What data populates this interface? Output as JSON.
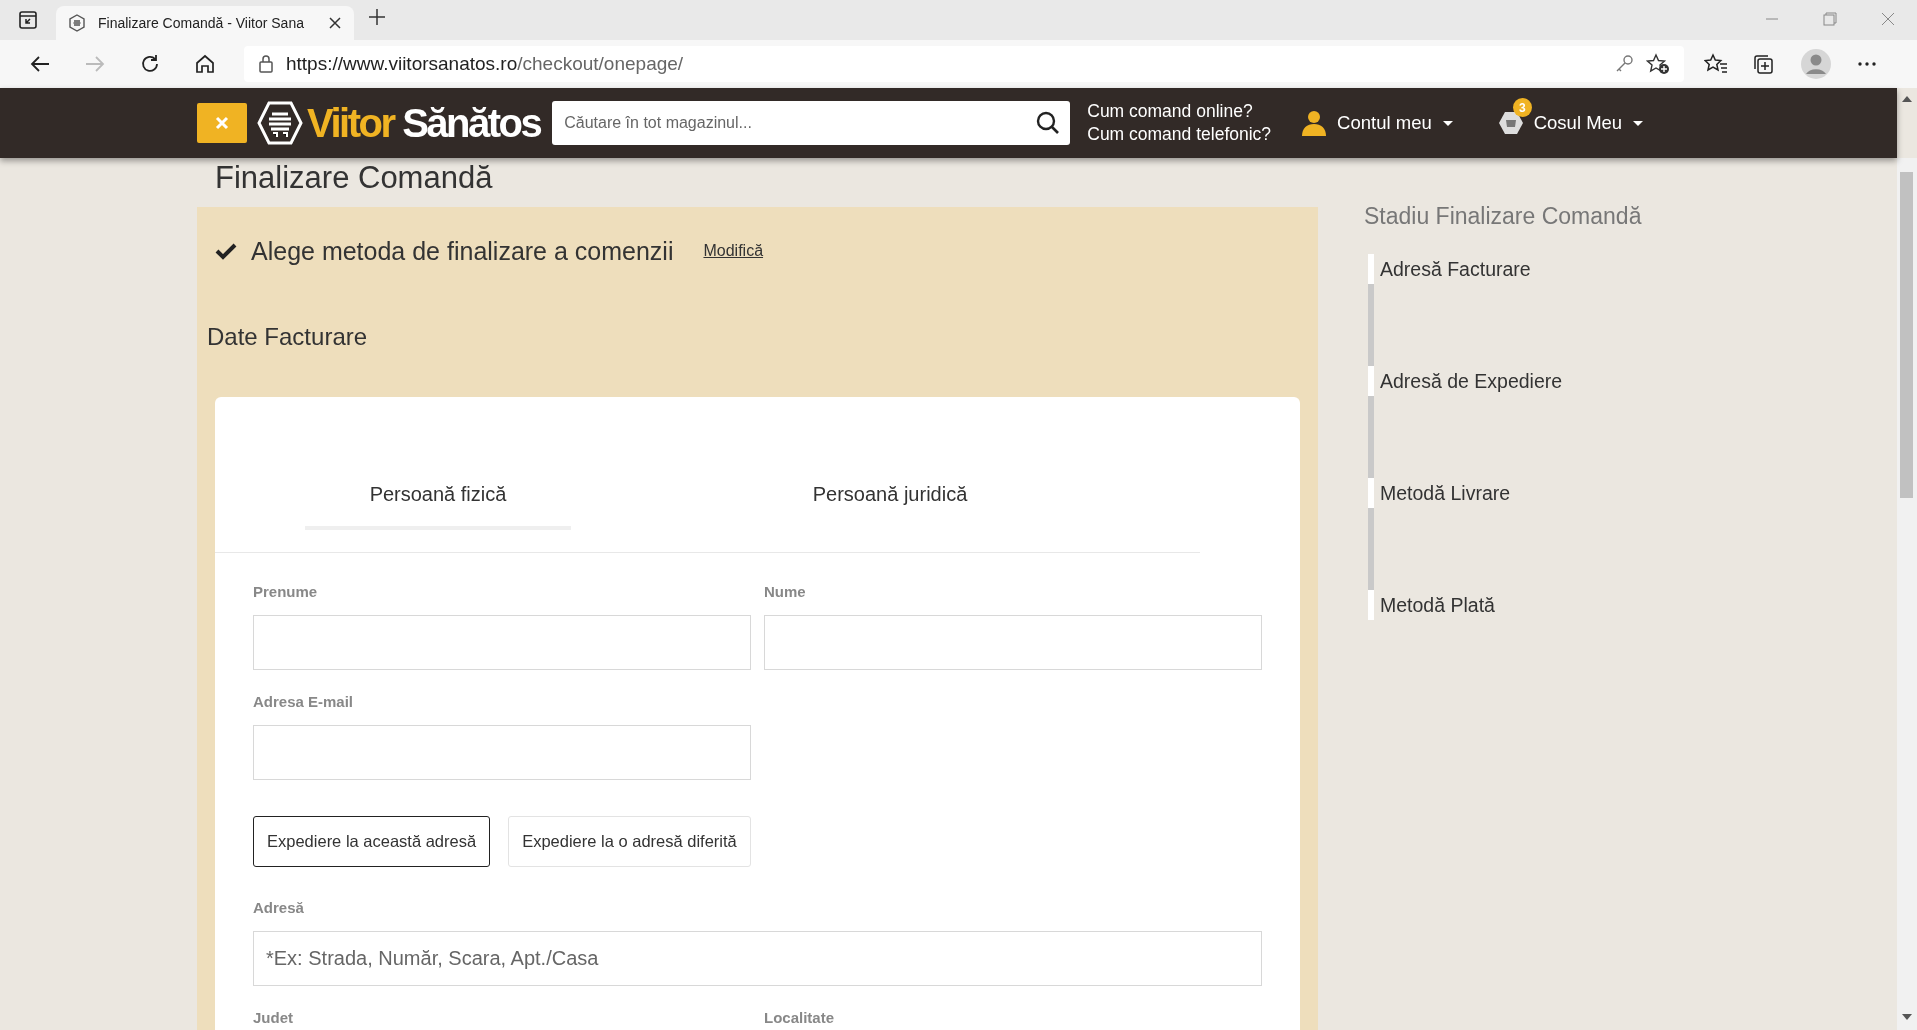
{
  "browser": {
    "tab_title": "Finalizare Comandă - Viitor Sana",
    "url_host": "https://www.viitorsanatos.ro",
    "url_path": "/checkout/onepage/"
  },
  "header": {
    "brand": [
      "Viitor",
      "Sănătos"
    ],
    "search": {
      "placeholder": "Căutare în tot magazinul..."
    },
    "help_links": [
      "Cum comand online?",
      "Cum comand telefonic?"
    ],
    "account": "Contul meu",
    "cart": {
      "label": "Cosul Meu",
      "count": "3"
    }
  },
  "page_title": "Finalizare Comandă",
  "step": {
    "text": "Alege metoda de finalizare a comenzii",
    "link": "Modifică"
  },
  "section_title": "Date Facturare",
  "tabs": [
    {
      "label": "Persoană fizică",
      "selected": true
    },
    {
      "label": "Persoană juridică",
      "selected": false
    }
  ],
  "fields_top": [
    {
      "label": "Prenume",
      "kind": "half"
    },
    {
      "label": "Nume",
      "kind": "half"
    },
    {
      "label": "Adresa E-mail",
      "kind": "half"
    }
  ],
  "shipping_options": [
    {
      "label": "Expediere la această adresă",
      "selected": true
    },
    {
      "label": "Expediere la o adresă diferită",
      "selected": false
    }
  ],
  "fields_bottom": [
    {
      "label": "Adresă",
      "kind": "full",
      "placeholder": "*Ex: Strada, Număr, Scara, Apt./Casa"
    },
    {
      "label": "Judet",
      "kind": "label_only"
    },
    {
      "label": "Localitate",
      "kind": "label_only"
    }
  ],
  "sidebar": {
    "title": "Stadiu Finalizare Comandă",
    "steps": [
      "Adresă Facturare",
      "Adresă de Expediere",
      "Metodă Livrare",
      "Metodă Plată"
    ]
  }
}
